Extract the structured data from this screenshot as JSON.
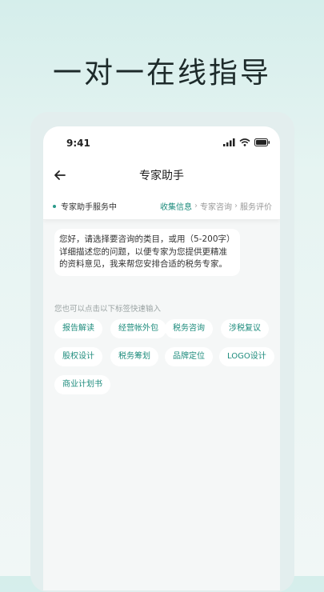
{
  "headline": "一对一在线指导",
  "status_bar": {
    "time": "9:41",
    "icons": [
      "signal-icon",
      "wifi-icon",
      "battery-icon"
    ]
  },
  "nav": {
    "title": "专家助手",
    "back_icon": "arrow-left-icon"
  },
  "progress": {
    "service_status": "专家助手服务中",
    "steps": [
      {
        "label": "收集信息",
        "active": true
      },
      {
        "label": "专家咨询",
        "active": false
      },
      {
        "label": "服务评价",
        "active": false
      }
    ]
  },
  "message": {
    "text": "您好，请选择要咨询的类目，或用（5-200字）详细描述您的问题，以便专家为您提供更精准的资料意见，我来帮您安排合适的税务专家。"
  },
  "hint": "您也可以点击以下标签快速输入",
  "tags": [
    "报告解读",
    "经营帐外包",
    "税务咨询",
    "涉税复议",
    "股权设计",
    "税务筹划",
    "品牌定位",
    "LOGO设计",
    "商业计划书"
  ],
  "colors": {
    "accent": "#1e8c7d",
    "background_top": "#d5eeeb",
    "bubble": "#ffffff"
  }
}
